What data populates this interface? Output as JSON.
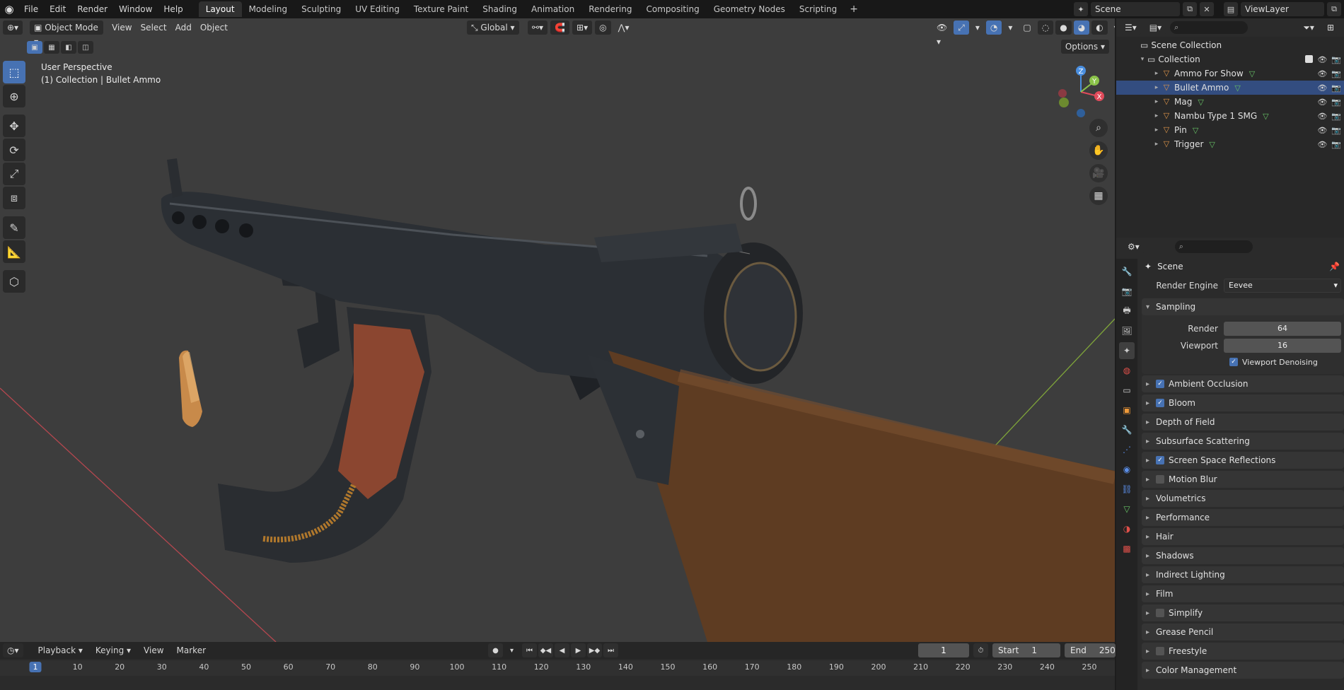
{
  "app": {
    "menus": [
      "File",
      "Edit",
      "Render",
      "Window",
      "Help"
    ],
    "workspaces": [
      "Layout",
      "Modeling",
      "Sculpting",
      "UV Editing",
      "Texture Paint",
      "Shading",
      "Animation",
      "Rendering",
      "Compositing",
      "Geometry Nodes",
      "Scripting"
    ],
    "active_workspace": "Layout",
    "add_workspace": "+",
    "scene": "Scene",
    "view_layer": "ViewLayer"
  },
  "viewport": {
    "mode": "Object Mode",
    "menus": [
      "View",
      "Select",
      "Add",
      "Object"
    ],
    "transform_orientation": "Global",
    "options": "Options",
    "info_line1": "User Perspective",
    "info_line2": "(1) Collection | Bullet Ammo",
    "gizmo": {
      "x": "X",
      "y": "Y",
      "z": "Z"
    }
  },
  "outliner": {
    "root": "Scene Collection",
    "collection": "Collection",
    "objects": [
      "Ammo For Show",
      "Bullet Ammo",
      "Mag",
      "Nambu Type 1 SMG",
      "Pin",
      "Trigger"
    ],
    "selected": "Bullet Ammo"
  },
  "properties": {
    "context": "Scene",
    "render_engine_label": "Render Engine",
    "render_engine": "Eevee",
    "sampling": {
      "title": "Sampling",
      "render_label": "Render",
      "render_value": "64",
      "viewport_label": "Viewport",
      "viewport_value": "16",
      "denoise_label": "Viewport Denoising",
      "denoise_checked": true
    },
    "panels": [
      {
        "label": "Ambient Occlusion",
        "checkbox": true,
        "checked": true
      },
      {
        "label": "Bloom",
        "checkbox": true,
        "checked": true
      },
      {
        "label": "Depth of Field",
        "checkbox": false
      },
      {
        "label": "Subsurface Scattering",
        "checkbox": false
      },
      {
        "label": "Screen Space Reflections",
        "checkbox": true,
        "checked": true
      },
      {
        "label": "Motion Blur",
        "checkbox": true,
        "checked": false
      },
      {
        "label": "Volumetrics",
        "checkbox": false
      },
      {
        "label": "Performance",
        "checkbox": false
      },
      {
        "label": "Hair",
        "checkbox": false
      },
      {
        "label": "Shadows",
        "checkbox": false
      },
      {
        "label": "Indirect Lighting",
        "checkbox": false
      },
      {
        "label": "Film",
        "checkbox": false
      },
      {
        "label": "Simplify",
        "checkbox": true,
        "checked": false
      },
      {
        "label": "Grease Pencil",
        "checkbox": false
      },
      {
        "label": "Freestyle",
        "checkbox": true,
        "checked": false
      },
      {
        "label": "Color Management",
        "checkbox": false
      }
    ]
  },
  "timeline": {
    "menus": [
      "Playback",
      "Keying",
      "View",
      "Marker"
    ],
    "current_frame": "1",
    "start_label": "Start",
    "start": "1",
    "end_label": "End",
    "end": "250",
    "ruler_ticks": [
      "10",
      "20",
      "30",
      "40",
      "50",
      "60",
      "70",
      "80",
      "90",
      "100",
      "110",
      "120",
      "130",
      "140",
      "150",
      "160",
      "170",
      "180",
      "190",
      "200",
      "210",
      "220",
      "230",
      "240",
      "250"
    ],
    "cursor_frame": "1"
  },
  "colors": {
    "accent": "#4772b3",
    "viewport_bg": "#3d3d3d",
    "x_axis": "#e04b5b",
    "y_axis": "#8bc34a",
    "z_axis": "#4a8fe0"
  }
}
